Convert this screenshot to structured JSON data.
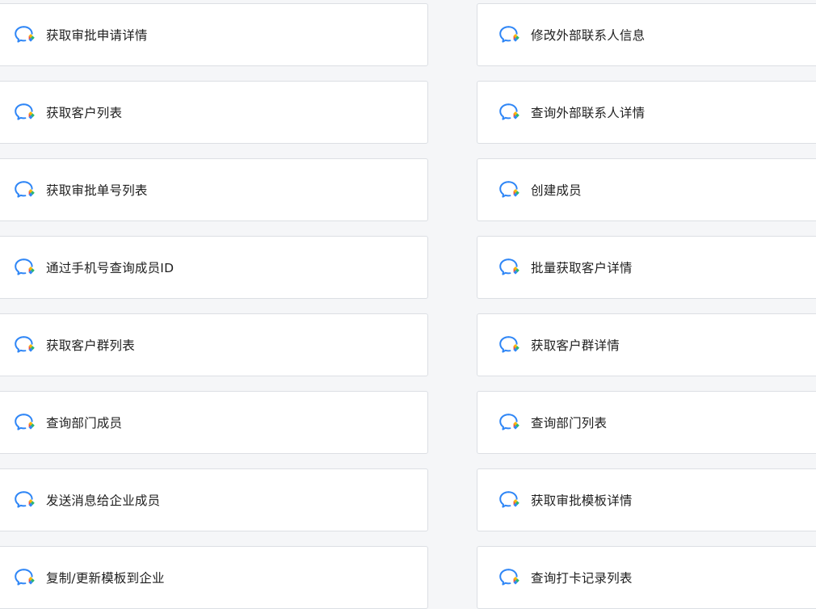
{
  "app_icon": "wecom-chat-bubble-icon",
  "colors": {
    "page_background": "#f5f6f8",
    "card_background": "#ffffff",
    "card_border": "#dcdfe4",
    "text": "#1f1f1f",
    "icon_blue": "#2f86f6",
    "icon_yellow": "#f7b500",
    "icon_green": "#2ab673",
    "icon_red": "#f0483e"
  },
  "left_column": {
    "items": [
      {
        "label": "获取审批申请详情"
      },
      {
        "label": "获取客户列表"
      },
      {
        "label": "获取审批单号列表"
      },
      {
        "label": "通过手机号查询成员ID"
      },
      {
        "label": "获取客户群列表"
      },
      {
        "label": "查询部门成员"
      },
      {
        "label": "发送消息给企业成员"
      },
      {
        "label": "复制/更新模板到企业"
      }
    ]
  },
  "right_column": {
    "items": [
      {
        "label": "修改外部联系人信息"
      },
      {
        "label": "查询外部联系人详情"
      },
      {
        "label": "创建成员"
      },
      {
        "label": "批量获取客户详情"
      },
      {
        "label": "获取客户群详情"
      },
      {
        "label": "查询部门列表"
      },
      {
        "label": "获取审批模板详情"
      },
      {
        "label": "查询打卡记录列表"
      }
    ]
  }
}
